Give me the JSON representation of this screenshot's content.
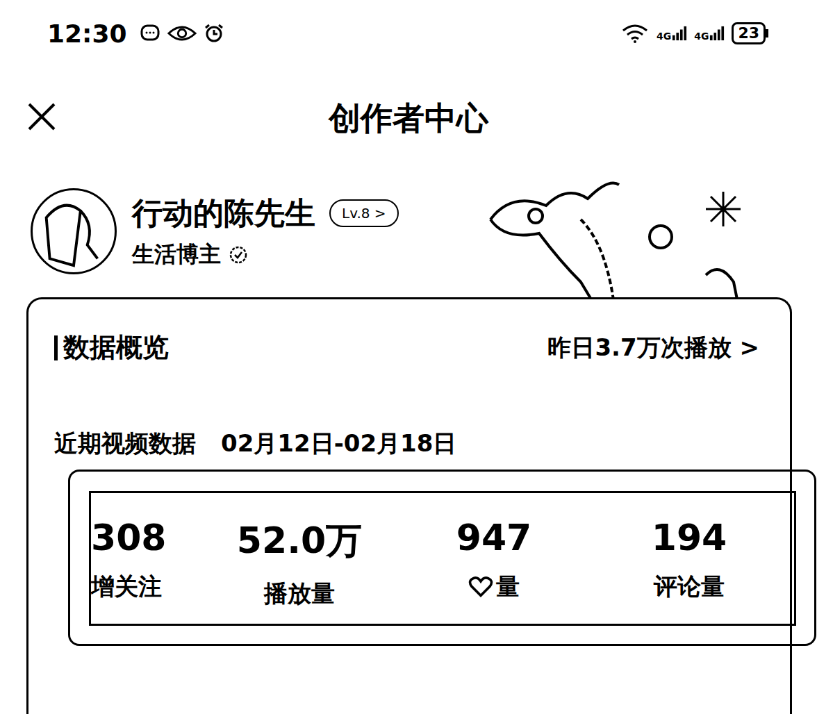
{
  "status_bar": {
    "time": "12:30",
    "network": [
      "4G",
      "4G"
    ],
    "battery": "23"
  },
  "header": {
    "title": "创作者中心"
  },
  "profile": {
    "name": "行动的陈先生",
    "level": "Lv.8",
    "level_arrow": ">",
    "role": "生活博主"
  },
  "overview": {
    "title": "数据概览",
    "yesterday": "昨日3.7万次播放",
    "arrow": ">"
  },
  "recent": {
    "label": "近期视频数据",
    "range": "02月12日-02月18日"
  },
  "stats": [
    {
      "value": "308",
      "label": "增关注",
      "kind": "plain"
    },
    {
      "value": "52.0万",
      "label": "播放量",
      "kind": "plain"
    },
    {
      "value": "947",
      "label": "量",
      "kind": "heart"
    },
    {
      "value": "194",
      "label": "评论量",
      "kind": "plain"
    }
  ]
}
